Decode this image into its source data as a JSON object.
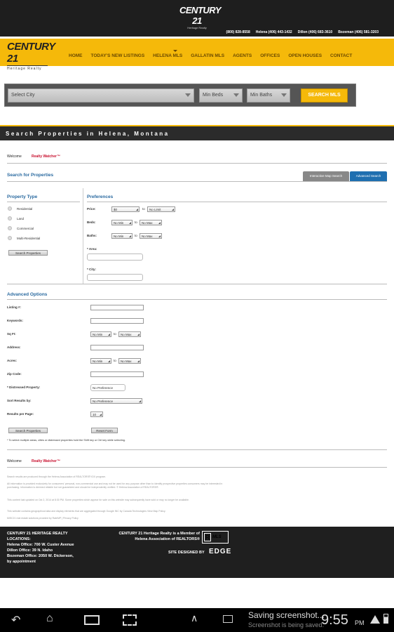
{
  "header": {
    "logo_brand": "CENTURY 21",
    "logo_sub": "Heritage Realty",
    "phones": [
      "(800) 828-8558",
      "Helena (406) 443-1432",
      "Dillon (406) 683-3610",
      "Bozeman (406) 581-3203"
    ]
  },
  "nav": {
    "logo_brand": "CENTURY 21",
    "logo_sub": "Heritage Realty",
    "items": [
      "HOME",
      "TODAY'S NEW LISTINGS",
      "HELENA MLS",
      "GALLATIN MLS",
      "AGENTS",
      "OFFICES",
      "OPEN HOUSES",
      "CONTACT"
    ]
  },
  "quick_search": {
    "city": "Select City",
    "beds": "Min Beds",
    "baths": "Min Baths",
    "button": "SEARCH MLS"
  },
  "section_title": "Search Properties in Helena, Montana",
  "welcome": {
    "label": "Welcome",
    "link": "Realty Watcher™"
  },
  "search": {
    "title": "Search for Properties",
    "tab_map": "Interactive Map Search",
    "tab_adv": "Advanced Search"
  },
  "property_type": {
    "title": "Property Type",
    "options": [
      "Residential",
      "Land",
      "Commercial",
      "Multi-Residential"
    ],
    "button": "Search Properties"
  },
  "preferences": {
    "title": "Preferences",
    "price_label": "Price:",
    "price_min": "$0",
    "price_max": "No Limit",
    "beds_label": "Beds:",
    "baths_label": "Baths:",
    "no_min": "No Min",
    "no_max": "No Max",
    "to": "to",
    "area_label": "* Area:",
    "city_label": "* City:"
  },
  "advanced": {
    "title": "Advanced Options",
    "listing": "Listing #:",
    "keywords": "Keywords:",
    "sqft": "Sq Ft:",
    "address": "Address:",
    "acres": "Acres:",
    "zip": "Zip Code:",
    "distressed": "* Distressed Property:",
    "distressed_value": "No Preference",
    "sort": "Sort Results by:",
    "sort_value": "No Preference",
    "per_page": "Results per Page:",
    "per_page_value": "10",
    "btn_search": "Search Properties",
    "btn_reset": "Reset Form",
    "note": "* To select multiple areas, cities or distressed properties hold the Shift key or Ctrl key while selecting."
  },
  "welcome2": {
    "label": "Welcome",
    "link": "Realty Watcher™"
  },
  "disclaimers": [
    "Search results are produced through the Helena Association of REALTORS® IDX program.",
    "All information is provided exclusively for consumers' personal, non-commercial use and may not be used for any purpose other than to identify prospective properties consumers may be interested in purchasing. Information is deemed reliable but not guaranteed and should be independently verified. © Helena Association of REALTORS®.",
    "This content last updated on Oct 2, 2014 at 8:30 PM. Some properties which appear for sale on this website may subsequently have sold or may no longer be available.",
    "This website contains geographical data and display elements that are aggregated through Google INC by Canada Technologies View Map Policy.",
    "MiSC21 real estate solutions provided by RateMP | Privacy Policy"
  ],
  "footer": {
    "locations_title": "CENTURY 21 HERITAGE REALTY LOCATIONS:",
    "helena": "Helena Office: 700 W. Custer Avenue",
    "dillon": "Dillon Office: 39 N. Idaho",
    "bozeman": "Bozeman Office: 2050 W. Dickerson,",
    "appointment": "by appointment",
    "member": "CENTURY 21 Heritage Realty is a Member of",
    "association": "Helena Association of REALTORS®",
    "designed": "SITE DESIGNED BY",
    "designer": "EDGE"
  },
  "system": {
    "notif_title": "Saving screenshot...",
    "notif_sub": "Screenshot is being saved.",
    "time": "9:55",
    "ampm": "PM"
  }
}
